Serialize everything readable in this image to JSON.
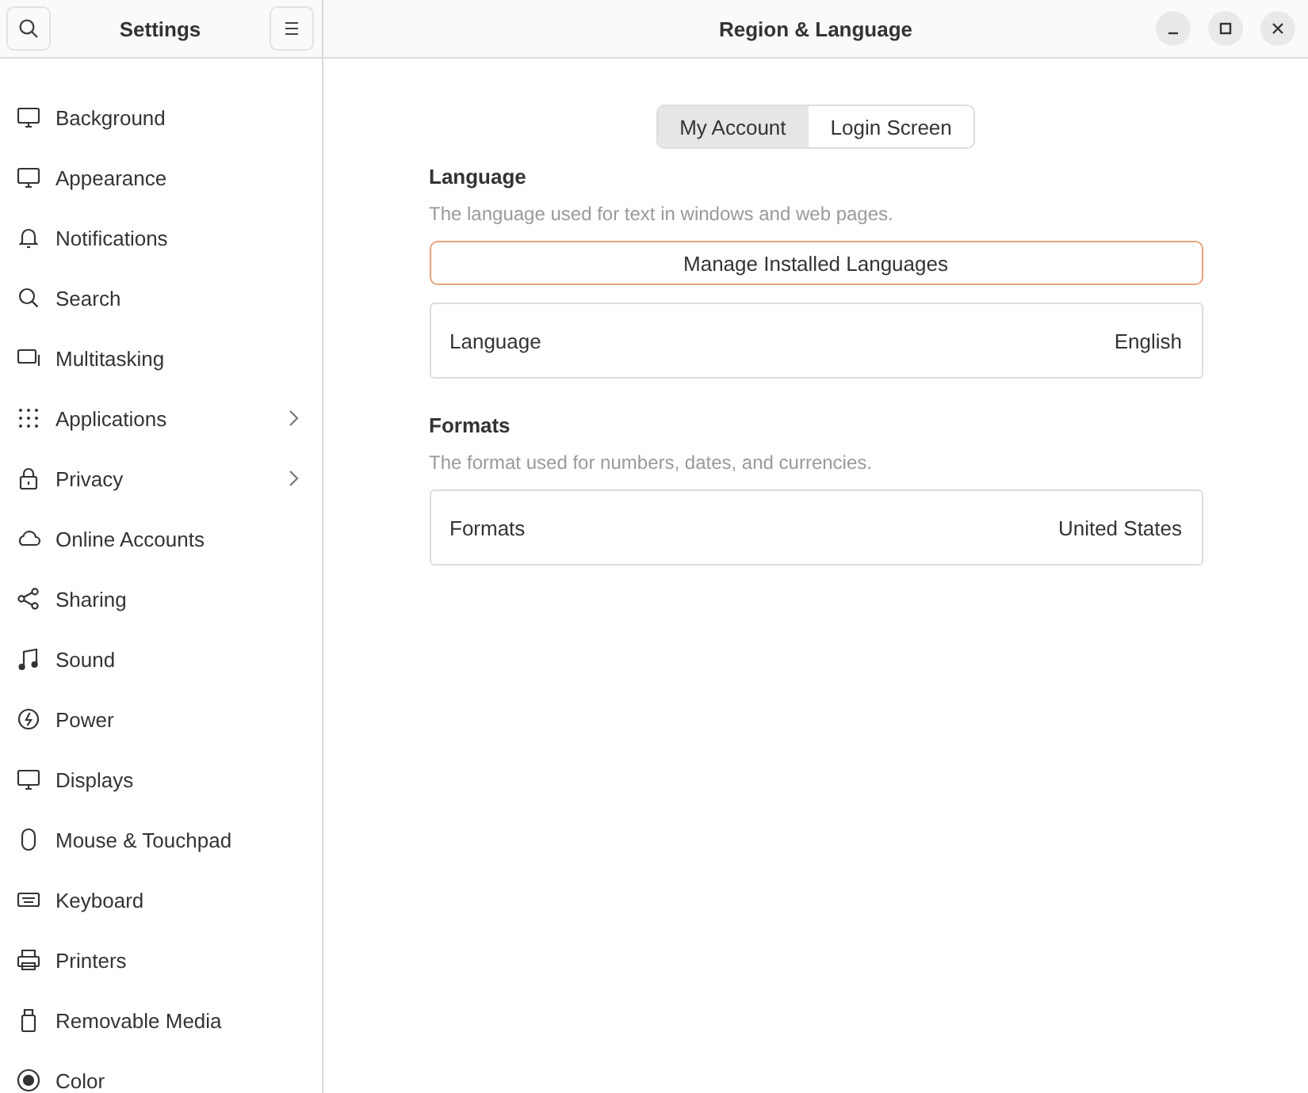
{
  "sidebar": {
    "title": "Settings",
    "items": [
      {
        "label": "Background",
        "has_submenu": false
      },
      {
        "label": "Appearance",
        "has_submenu": false
      },
      {
        "label": "Notifications",
        "has_submenu": false
      },
      {
        "label": "Search",
        "has_submenu": false
      },
      {
        "label": "Multitasking",
        "has_submenu": false
      },
      {
        "label": "Applications",
        "has_submenu": true
      },
      {
        "label": "Privacy",
        "has_submenu": true
      },
      {
        "label": "Online Accounts",
        "has_submenu": false
      },
      {
        "label": "Sharing",
        "has_submenu": false
      },
      {
        "label": "Sound",
        "has_submenu": false
      },
      {
        "label": "Power",
        "has_submenu": false
      },
      {
        "label": "Displays",
        "has_submenu": false
      },
      {
        "label": "Mouse & Touchpad",
        "has_submenu": false
      },
      {
        "label": "Keyboard",
        "has_submenu": false
      },
      {
        "label": "Printers",
        "has_submenu": false
      },
      {
        "label": "Removable Media",
        "has_submenu": false
      },
      {
        "label": "Color",
        "has_submenu": false
      }
    ]
  },
  "window": {
    "title": "Region & Language"
  },
  "tabs": [
    {
      "label": "My Account",
      "selected": true
    },
    {
      "label": "Login Screen",
      "selected": false
    }
  ],
  "sections": [
    {
      "heading": "Language",
      "description": "The language used for text in windows and web pages.",
      "button": "Manage Installed Languages",
      "row": {
        "label": "Language",
        "value": "English"
      }
    },
    {
      "heading": "Formats",
      "description": "The format used for numbers, dates, and currencies.",
      "row": {
        "label": "Formats",
        "value": "United States"
      }
    }
  ]
}
